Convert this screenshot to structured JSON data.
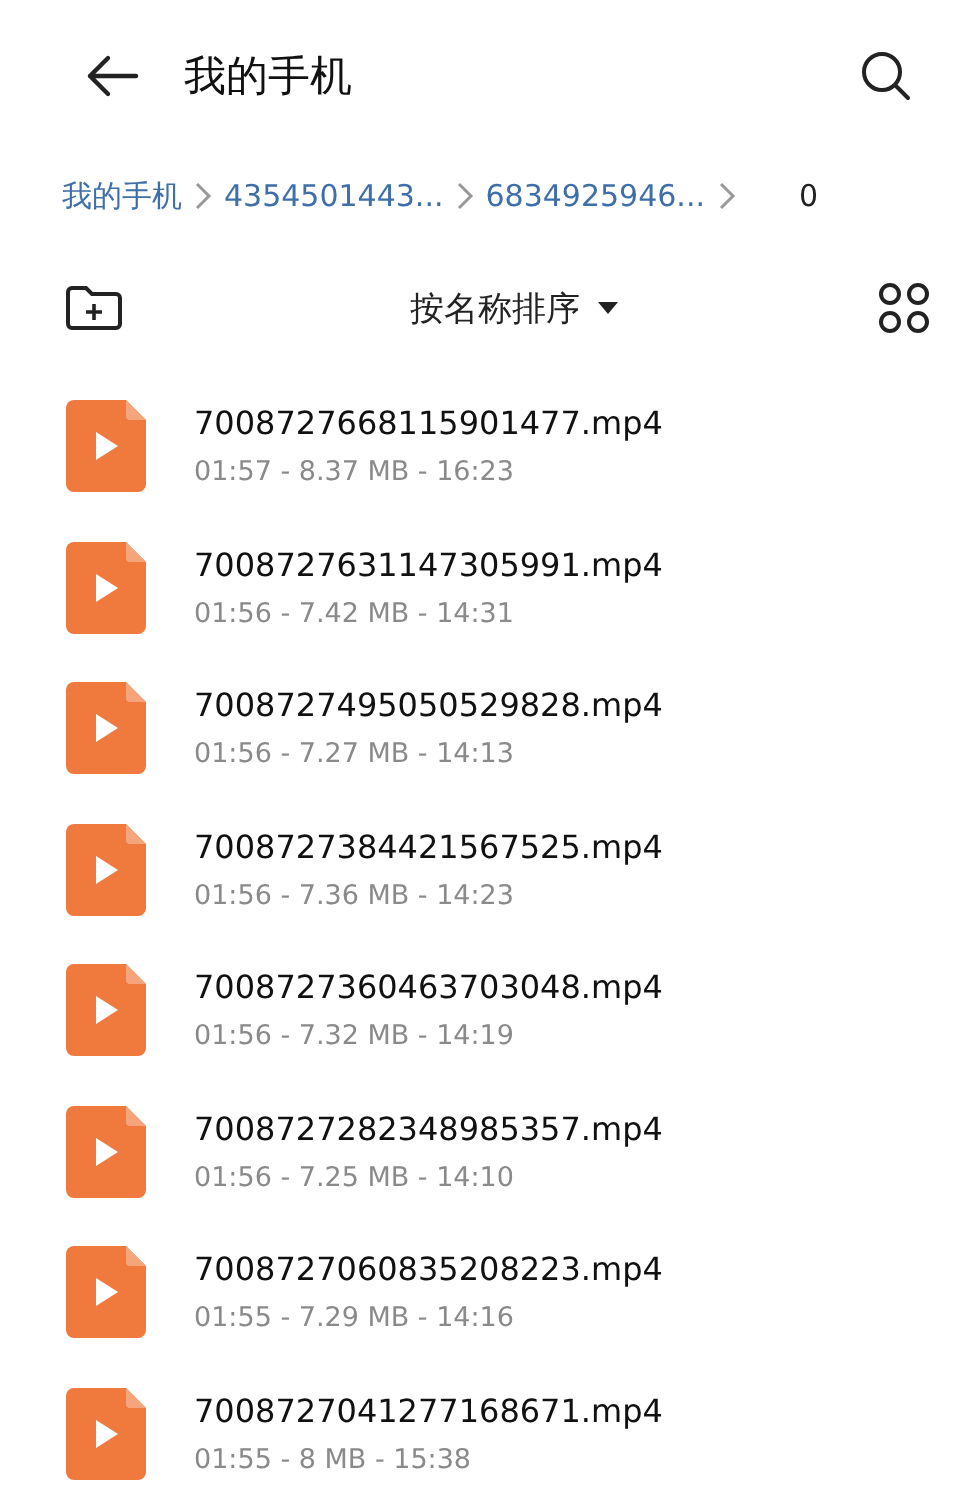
{
  "header": {
    "title": "我的手机"
  },
  "breadcrumbs": [
    "我的手机",
    "4354501443...",
    "6834925946...",
    "0"
  ],
  "sort": {
    "label": "按名称排序"
  },
  "files": [
    {
      "name": "7008727668115901477.mp4",
      "meta": "01:57 - 8.37 MB - 16:23"
    },
    {
      "name": "7008727631147305991.mp4",
      "meta": "01:56 - 7.42 MB - 14:31"
    },
    {
      "name": "7008727495050529828.mp4",
      "meta": "01:56 - 7.27 MB - 14:13"
    },
    {
      "name": "7008727384421567525.mp4",
      "meta": "01:56 - 7.36 MB - 14:23"
    },
    {
      "name": "7008727360463703048.mp4",
      "meta": "01:56 - 7.32 MB - 14:19"
    },
    {
      "name": "7008727282348985357.mp4",
      "meta": "01:56 - 7.25 MB - 14:10"
    },
    {
      "name": "7008727060835208223.mp4",
      "meta": "01:55 - 7.29 MB - 14:16"
    },
    {
      "name": "7008727041277168671.mp4",
      "meta": "01:55 - 8 MB - 15:38"
    }
  ]
}
